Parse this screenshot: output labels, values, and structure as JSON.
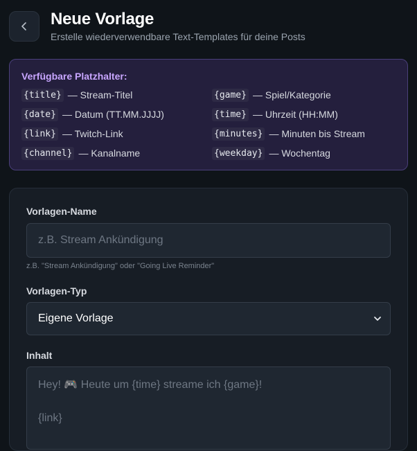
{
  "header": {
    "title": "Neue Vorlage",
    "subtitle": "Erstelle wiederverwendbare Text-Templates für deine Posts"
  },
  "placeholders": {
    "heading": "Verfügbare Platzhalter:",
    "items": [
      {
        "code": "{title}",
        "desc": "— Stream-Titel"
      },
      {
        "code": "{game}",
        "desc": "— Spiel/Kategorie"
      },
      {
        "code": "{date}",
        "desc": "— Datum (TT.MM.JJJJ)"
      },
      {
        "code": "{time}",
        "desc": "— Uhrzeit (HH:MM)"
      },
      {
        "code": "{link}",
        "desc": "— Twitch-Link"
      },
      {
        "code": "{minutes}",
        "desc": "— Minuten bis Stream"
      },
      {
        "code": "{channel}",
        "desc": "— Kanalname"
      },
      {
        "code": "{weekday}",
        "desc": "— Wochentag"
      }
    ]
  },
  "form": {
    "name_label": "Vorlagen-Name",
    "name_placeholder": "z.B. Stream Ankündigung",
    "name_hint": "z.B. \"Stream Ankündigung\" oder \"Going Live Reminder\"",
    "type_label": "Vorlagen-Typ",
    "type_value": "Eigene Vorlage",
    "content_label": "Inhalt",
    "content_placeholder_line1": "Hey! 🎮 Heute um {time} streame ich {game}!",
    "content_placeholder_line2": "{link}"
  }
}
